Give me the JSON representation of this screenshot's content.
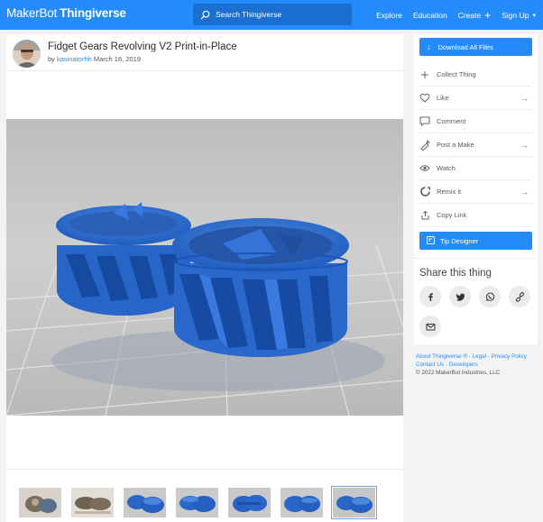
{
  "nav": {
    "logo_left": "MakerBot",
    "logo_right": "Thingiverse",
    "search_placeholder": "Search Thingiverse",
    "links": [
      "Explore",
      "Education",
      "Create",
      "Sign Up"
    ]
  },
  "thing": {
    "title": "Fidget Gears Revolving V2 Print-in-Place",
    "by": "by",
    "author": "kasinatorhh",
    "date": "March 16, 2019"
  },
  "sidebar": {
    "download_label": "Download All Files",
    "actions": [
      {
        "label": "Collect Thing",
        "icon": "plus-icon",
        "arrow": false
      },
      {
        "label": "Like",
        "icon": "heart-icon",
        "arrow": true
      },
      {
        "label": "Comment",
        "icon": "comment-icon",
        "arrow": false
      },
      {
        "label": "Post a Make",
        "icon": "make-icon",
        "arrow": true
      },
      {
        "label": "Watch",
        "icon": "eye-icon",
        "arrow": false
      },
      {
        "label": "Remix it",
        "icon": "remix-icon",
        "arrow": true
      },
      {
        "label": "Copy Link",
        "icon": "share-icon",
        "arrow": false
      }
    ],
    "tip_label": "Tip Designer",
    "share_heading": "Share this thing"
  },
  "footer": {
    "about": "About Thingiverse ®",
    "legal": "Legal",
    "privacy": "Privacy Policy",
    "contact": "Contact Us",
    "developers": "Developers",
    "copyright": "© 2022 MakerBot Industries, LLC"
  },
  "thumbnails": [
    "photo-1",
    "photo-2",
    "render-1",
    "render-2",
    "render-3",
    "render-4",
    "render-5"
  ],
  "colors": {
    "brand": "#248BFB",
    "model": "#2E6FD0"
  }
}
